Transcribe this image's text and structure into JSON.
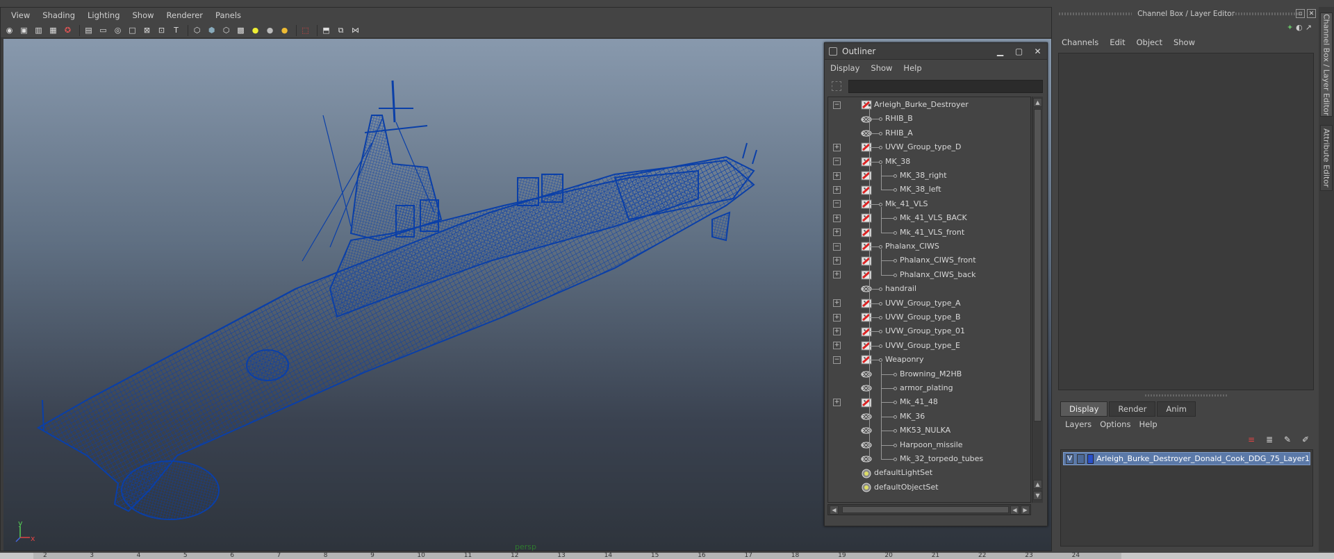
{
  "viewport": {
    "menu": [
      "View",
      "Shading",
      "Lighting",
      "Show",
      "Renderer",
      "Panels"
    ],
    "camera_label": "persp",
    "axis": {
      "x": "x",
      "y": "y"
    }
  },
  "outliner": {
    "title": "Outliner",
    "menu": [
      "Display",
      "Show",
      "Help"
    ],
    "search_value": "",
    "items": [
      {
        "label": "Arleigh_Burke_Destroyer",
        "depth": 0,
        "expander": "minus",
        "icon": "transform-icon"
      },
      {
        "label": "RHIB_B",
        "depth": 1,
        "expander": "",
        "icon": "mesh-icon"
      },
      {
        "label": "RHIB_A",
        "depth": 1,
        "expander": "",
        "icon": "mesh-icon"
      },
      {
        "label": "UVW_Group_type_D",
        "depth": 1,
        "expander": "plus",
        "icon": "transform-icon"
      },
      {
        "label": "MK_38",
        "depth": 1,
        "expander": "minus",
        "icon": "transform-icon"
      },
      {
        "label": "MK_38_right",
        "depth": 2,
        "expander": "plus",
        "icon": "transform-icon"
      },
      {
        "label": "MK_38_left",
        "depth": 2,
        "expander": "plus",
        "icon": "transform-icon"
      },
      {
        "label": "Mk_41_VLS",
        "depth": 1,
        "expander": "minus",
        "icon": "transform-icon"
      },
      {
        "label": "Mk_41_VLS_BACK",
        "depth": 2,
        "expander": "plus",
        "icon": "transform-icon"
      },
      {
        "label": "Mk_41_VLS_front",
        "depth": 2,
        "expander": "plus",
        "icon": "transform-icon"
      },
      {
        "label": "Phalanx_CIWS",
        "depth": 1,
        "expander": "minus",
        "icon": "transform-icon"
      },
      {
        "label": "Phalanx_CIWS_front",
        "depth": 2,
        "expander": "plus",
        "icon": "transform-icon"
      },
      {
        "label": "Phalanx_CIWS_back",
        "depth": 2,
        "expander": "plus",
        "icon": "transform-icon"
      },
      {
        "label": "handrail",
        "depth": 1,
        "expander": "",
        "icon": "mesh-icon"
      },
      {
        "label": "UVW_Group_type_A",
        "depth": 1,
        "expander": "plus",
        "icon": "transform-icon"
      },
      {
        "label": "UVW_Group_type_B",
        "depth": 1,
        "expander": "plus",
        "icon": "transform-icon"
      },
      {
        "label": "UVW_Group_type_01",
        "depth": 1,
        "expander": "plus",
        "icon": "transform-icon"
      },
      {
        "label": "UVW_Group_type_E",
        "depth": 1,
        "expander": "plus",
        "icon": "transform-icon"
      },
      {
        "label": "Weaponry",
        "depth": 1,
        "expander": "minus",
        "icon": "transform-icon"
      },
      {
        "label": "Browning_M2HB",
        "depth": 2,
        "expander": "",
        "icon": "mesh-icon"
      },
      {
        "label": "armor_plating",
        "depth": 2,
        "expander": "",
        "icon": "mesh-icon"
      },
      {
        "label": "Mk_41_48",
        "depth": 2,
        "expander": "plus",
        "icon": "transform-icon"
      },
      {
        "label": "MK_36",
        "depth": 2,
        "expander": "",
        "icon": "mesh-icon"
      },
      {
        "label": "MK53_NULKA",
        "depth": 2,
        "expander": "",
        "icon": "mesh-icon"
      },
      {
        "label": "Harpoon_missile",
        "depth": 2,
        "expander": "",
        "icon": "mesh-icon"
      },
      {
        "label": "Mk_32_torpedo_tubes",
        "depth": 2,
        "expander": "",
        "icon": "mesh-icon"
      },
      {
        "label": "defaultLightSet",
        "depth": -1,
        "expander": "",
        "icon": "set-icon"
      },
      {
        "label": "defaultObjectSet",
        "depth": -1,
        "expander": "",
        "icon": "set-icon"
      }
    ]
  },
  "channel_box": {
    "title": "Channel Box / Layer Editor",
    "menu": [
      "Channels",
      "Edit",
      "Object",
      "Show"
    ]
  },
  "layer_editor": {
    "tabs": [
      "Display",
      "Render",
      "Anim"
    ],
    "active_tab": "Display",
    "menu": [
      "Layers",
      "Options",
      "Help"
    ],
    "layers": [
      {
        "visible": "V",
        "name": "Arleigh_Burke_Destroyer_Donald_Cook_DDG_75_Layer1",
        "color": "#2950c8"
      }
    ]
  },
  "side_tabs": [
    "Channel Box / Layer Editor",
    "Attribute Editor"
  ],
  "timeline": {
    "ticks": [
      "2",
      "3",
      "4",
      "5",
      "6",
      "7",
      "8",
      "9",
      "10",
      "11",
      "12",
      "13",
      "14",
      "15",
      "16",
      "17",
      "18",
      "19",
      "20",
      "21",
      "22",
      "23",
      "24"
    ]
  },
  "colors": {
    "wireframe": "#0a3fa8",
    "layer_selected": "#5b79a8"
  }
}
